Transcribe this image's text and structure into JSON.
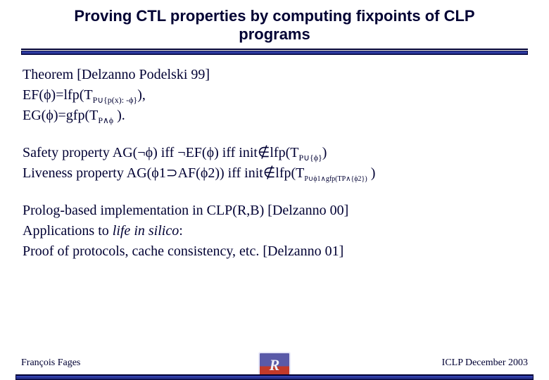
{
  "title_line1": "Proving CTL properties by computing fixpoints of CLP",
  "title_line2": "programs",
  "block1": {
    "l1": "Theorem [Delzanno Podelski 99]",
    "l2_a": "EF(",
    "l2_b": ")=lfp(T",
    "l2_c": "),",
    "l2_sub": "P∪{p(x): -ϕ}",
    "l3_a": "EG(",
    "l3_b": ")=gfp(T",
    "l3_c": " ).",
    "l3_sub": "P∧ϕ"
  },
  "block2": {
    "l1_a": "Safety property AG(¬",
    "l1_b": ") iff ¬EF(",
    "l1_c": ") iff init∉lfp(T",
    "l1_d": ")",
    "l1_sub": "P∪{ϕ}",
    "l2_a": "Liveness property AG(",
    "l2_b": "1⊃AF(",
    "l2_c": "2)) iff init∉lfp(T",
    "l2_d": "   )",
    "l2_sub": "P∪ϕ1∧gfp(TP∧{ϕ2})"
  },
  "block3": {
    "l1": "Prolog-based implementation in CLP(R,B) [Delzanno 00]",
    "l2_a": "Applications to ",
    "l2_b": "life in silico",
    "l2_c": ":",
    "l3": "Proof of protocols, cache consistency, etc. [Delzanno 01]"
  },
  "footer": {
    "left": "François Fages",
    "right": "ICLP December 2003",
    "logo": "R"
  },
  "phi": "ϕ"
}
